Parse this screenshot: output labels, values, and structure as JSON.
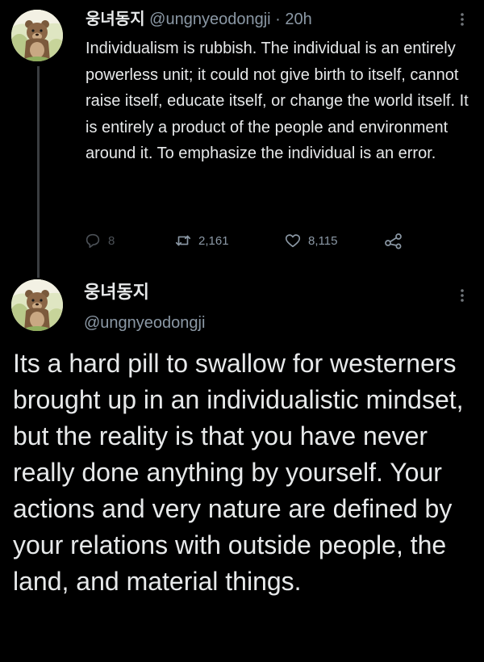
{
  "tweet1": {
    "author_name": "웅녀동지",
    "author_handle": "@ungnyeodongji",
    "separator": "·",
    "timestamp": "20h",
    "text": "Individualism is rubbish. The individual is an entirely powerless unit; it could not give birth to itself, cannot raise itself, educate itself, or change the world itself. It is entirely a product of the people and environment around it. To emphasize the individual is an error.",
    "avatar_icon": "bear-avatar-icon",
    "actions": {
      "reply_count": "8",
      "retweet_count": "2,161",
      "like_count": "8,115"
    }
  },
  "tweet2": {
    "author_name": "웅녀동지",
    "author_handle": "@ungnyeodongji",
    "avatar_icon": "bear-avatar-icon",
    "text": "Its a hard pill to swallow for westerners brought up in an individualistic mindset, but the reality is that you have never really done anything by yourself. Your actions and very nature are defined by your relations with outside people, the land, and material things."
  },
  "colors": {
    "background": "#000000",
    "text_primary": "#e7e9ea",
    "text_secondary": "#8b98a5",
    "thread_line": "#3a3d40"
  }
}
